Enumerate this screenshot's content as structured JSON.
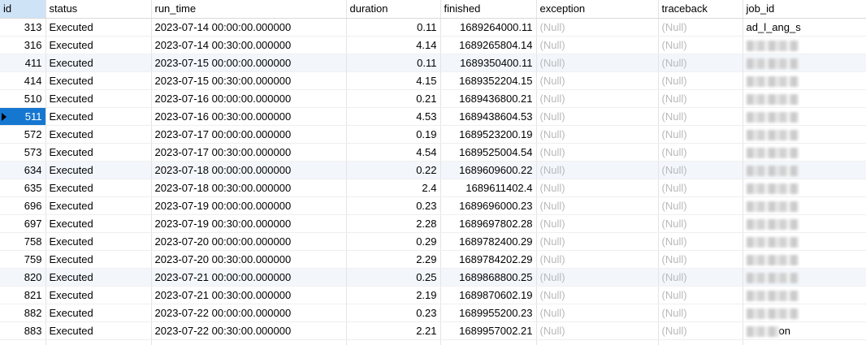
{
  "columns": [
    {
      "key": "id",
      "label": "id"
    },
    {
      "key": "status",
      "label": "status"
    },
    {
      "key": "run_time",
      "label": "run_time"
    },
    {
      "key": "duration",
      "label": "duration"
    },
    {
      "key": "finished",
      "label": "finished"
    },
    {
      "key": "exception",
      "label": "exception"
    },
    {
      "key": "traceback",
      "label": "traceback"
    },
    {
      "key": "job_id",
      "label": "job_id"
    }
  ],
  "selected_column": "id",
  "current_row_index": 5,
  "rows": [
    {
      "id": "313",
      "status": "Executed",
      "run_time": "2023-07-14 00:00:00.000000",
      "duration": "0.11",
      "finished": "1689264000.11",
      "exception": "(Null)",
      "traceback": "(Null)",
      "job_id": "ad_l_ang_s"
    },
    {
      "id": "316",
      "status": "Executed",
      "run_time": "2023-07-14 00:30:00.000000",
      "duration": "4.14",
      "finished": "1689265804.14",
      "exception": "(Null)",
      "traceback": "(Null)",
      "job_id": ""
    },
    {
      "id": "411",
      "status": "Executed",
      "run_time": "2023-07-15 00:00:00.000000",
      "duration": "0.11",
      "finished": "1689350400.11",
      "exception": "(Null)",
      "traceback": "(Null)",
      "job_id": ""
    },
    {
      "id": "414",
      "status": "Executed",
      "run_time": "2023-07-15 00:30:00.000000",
      "duration": "4.15",
      "finished": "1689352204.15",
      "exception": "(Null)",
      "traceback": "(Null)",
      "job_id": ""
    },
    {
      "id": "510",
      "status": "Executed",
      "run_time": "2023-07-16 00:00:00.000000",
      "duration": "0.21",
      "finished": "1689436800.21",
      "exception": "(Null)",
      "traceback": "(Null)",
      "job_id": ""
    },
    {
      "id": "511",
      "status": "Executed",
      "run_time": "2023-07-16 00:30:00.000000",
      "duration": "4.53",
      "finished": "1689438604.53",
      "exception": "(Null)",
      "traceback": "(Null)",
      "job_id": ""
    },
    {
      "id": "572",
      "status": "Executed",
      "run_time": "2023-07-17 00:00:00.000000",
      "duration": "0.19",
      "finished": "1689523200.19",
      "exception": "(Null)",
      "traceback": "(Null)",
      "job_id": ""
    },
    {
      "id": "573",
      "status": "Executed",
      "run_time": "2023-07-17 00:30:00.000000",
      "duration": "4.54",
      "finished": "1689525004.54",
      "exception": "(Null)",
      "traceback": "(Null)",
      "job_id": ""
    },
    {
      "id": "634",
      "status": "Executed",
      "run_time": "2023-07-18 00:00:00.000000",
      "duration": "0.22",
      "finished": "1689609600.22",
      "exception": "(Null)",
      "traceback": "(Null)",
      "job_id": ""
    },
    {
      "id": "635",
      "status": "Executed",
      "run_time": "2023-07-18 00:30:00.000000",
      "duration": "2.4",
      "finished": "1689611402.4",
      "exception": "(Null)",
      "traceback": "(Null)",
      "job_id": ""
    },
    {
      "id": "696",
      "status": "Executed",
      "run_time": "2023-07-19 00:00:00.000000",
      "duration": "0.23",
      "finished": "1689696000.23",
      "exception": "(Null)",
      "traceback": "(Null)",
      "job_id": ""
    },
    {
      "id": "697",
      "status": "Executed",
      "run_time": "2023-07-19 00:30:00.000000",
      "duration": "2.28",
      "finished": "1689697802.28",
      "exception": "(Null)",
      "traceback": "(Null)",
      "job_id": ""
    },
    {
      "id": "758",
      "status": "Executed",
      "run_time": "2023-07-20 00:00:00.000000",
      "duration": "0.29",
      "finished": "1689782400.29",
      "exception": "(Null)",
      "traceback": "(Null)",
      "job_id": ""
    },
    {
      "id": "759",
      "status": "Executed",
      "run_time": "2023-07-20 00:30:00.000000",
      "duration": "2.29",
      "finished": "1689784202.29",
      "exception": "(Null)",
      "traceback": "(Null)",
      "job_id": ""
    },
    {
      "id": "820",
      "status": "Executed",
      "run_time": "2023-07-21 00:00:00.000000",
      "duration": "0.25",
      "finished": "1689868800.25",
      "exception": "(Null)",
      "traceback": "(Null)",
      "job_id": ""
    },
    {
      "id": "821",
      "status": "Executed",
      "run_time": "2023-07-21 00:30:00.000000",
      "duration": "2.19",
      "finished": "1689870602.19",
      "exception": "(Null)",
      "traceback": "(Null)",
      "job_id": ""
    },
    {
      "id": "882",
      "status": "Executed",
      "run_time": "2023-07-22 00:00:00.000000",
      "duration": "0.23",
      "finished": "1689955200.23",
      "exception": "(Null)",
      "traceback": "(Null)",
      "job_id": ""
    },
    {
      "id": "883",
      "status": "Executed",
      "run_time": "2023-07-22 00:30:00.000000",
      "duration": "2.21",
      "finished": "1689957002.21",
      "exception": "(Null)",
      "traceback": "(Null)",
      "job_id": "on"
    }
  ]
}
